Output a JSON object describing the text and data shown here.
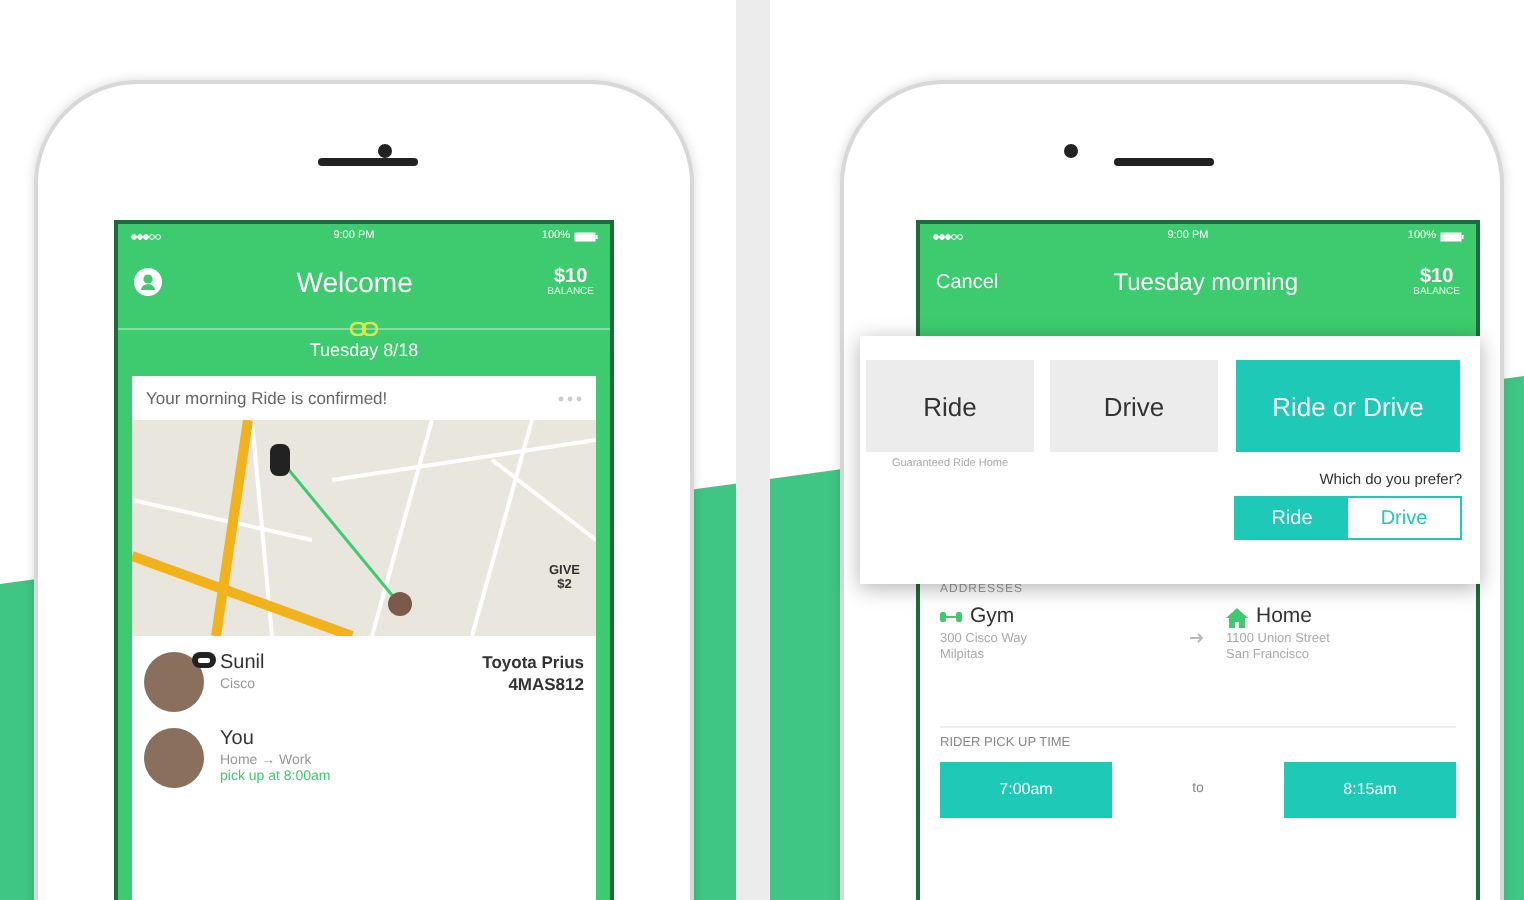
{
  "left_screen": {
    "status_bar": {
      "time": "9:00 PM",
      "battery": "100%"
    },
    "header": {
      "title": "Welcome",
      "balance": "$10",
      "balance_label": "BALANCE"
    },
    "date": "Tuesday 8/18",
    "card": {
      "message": "Your morning Ride is confirmed!",
      "map": {
        "give_label": "GIVE",
        "give_amount": "$2"
      },
      "people": [
        {
          "kind": "driver",
          "name": "Sunil",
          "detail": "Cisco",
          "car": "Toyota Prius",
          "plate": "4MAS812"
        },
        {
          "kind": "rider",
          "name": "You",
          "detail": "Home → Work",
          "pickup": "pick up at 8:00am"
        }
      ]
    }
  },
  "right_screen": {
    "status_bar": {
      "time": "9:00 PM",
      "battery": "100%"
    },
    "header": {
      "cancel": "Cancel",
      "title": "Tuesday morning",
      "balance": "$10",
      "balance_label": "BALANCE"
    },
    "modes": [
      {
        "label": "Ride",
        "sublabel": "Guaranteed Ride Home",
        "selected": false
      },
      {
        "label": "Drive",
        "selected": false
      },
      {
        "label": "Ride or Drive",
        "selected": true
      }
    ],
    "preference": {
      "question": "Which do you prefer?",
      "options": [
        {
          "label": "Ride",
          "selected": true
        },
        {
          "label": "Drive",
          "selected": false
        }
      ]
    },
    "addresses": {
      "heading": "ADDRESSES",
      "places": [
        {
          "kind": "gym",
          "name": "Gym",
          "lines": [
            "300 Cisco Way",
            "Milpitas"
          ]
        },
        {
          "kind": "home",
          "name": "Home",
          "lines": [
            "1100 Union Street",
            "San Francisco"
          ]
        }
      ]
    },
    "pickup_time": {
      "heading": "RIDER PICK UP TIME",
      "start": "7:00am",
      "separator": "to",
      "end": "8:15am"
    }
  }
}
